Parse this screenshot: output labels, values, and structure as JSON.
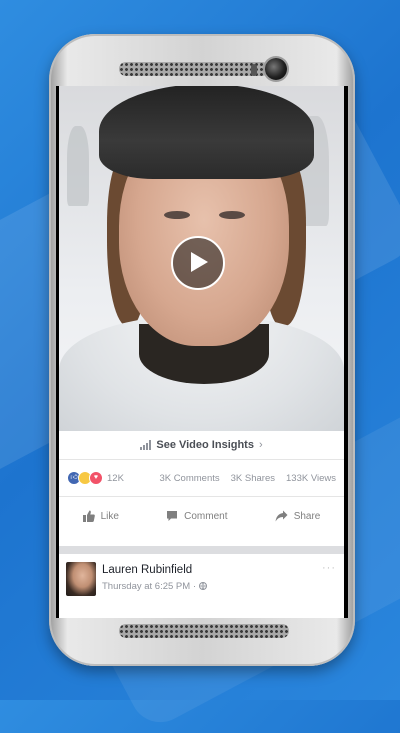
{
  "video": {
    "play_label": "play"
  },
  "insights": {
    "label": "See Video Insights"
  },
  "stats": {
    "reactions_count": "12K",
    "comments": "3K Comments",
    "shares": "3K Shares",
    "views": "133K Views"
  },
  "actions": {
    "like": "Like",
    "comment": "Comment",
    "share": "Share"
  },
  "post": {
    "author": "Lauren Rubinfield",
    "timestamp": "Thursday at 6:25 PM",
    "more": "···"
  },
  "icons": [
    "play-icon",
    "bars-chart-icon",
    "chevron-right-icon",
    "like-reaction-icon",
    "wow-reaction-icon",
    "love-reaction-icon",
    "thumbs-up-icon",
    "comment-icon",
    "share-arrow-icon",
    "globe-icon"
  ],
  "colors": {
    "background": "#2a86dd",
    "like_blue": "#4267b2",
    "muted_text": "#90949c"
  }
}
